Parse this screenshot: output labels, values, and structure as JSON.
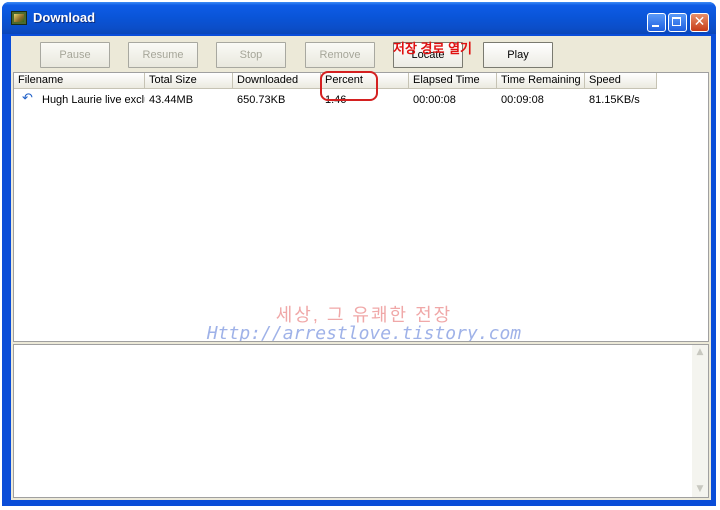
{
  "window": {
    "title": "Download"
  },
  "toolbar": {
    "pause": "Pause",
    "resume": "Resume",
    "stop": "Stop",
    "remove": "Remove",
    "locate": "Locate",
    "play": "Play"
  },
  "annotation": {
    "text": "저장 경로 열기",
    "color": "#e01010"
  },
  "table": {
    "columns": [
      "Filename",
      "Total Size",
      "Downloaded",
      "Percent",
      "Elapsed Time",
      "Time Remaining",
      "Speed"
    ],
    "rows": [
      {
        "filename": "Hugh Laurie live exclu...",
        "total_size": "43.44MB",
        "downloaded": "650.73KB",
        "percent": "1.46",
        "elapsed": "00:00:08",
        "remaining": "00:09:08",
        "speed": "81.15KB/s"
      }
    ]
  },
  "watermark": {
    "line1": "세상, 그 유쾌한 전장",
    "line2": "Http://arrestlove.tistory.com"
  },
  "icons": {
    "row_icon": "download-arrow-icon",
    "app_icon": "app-icon"
  }
}
